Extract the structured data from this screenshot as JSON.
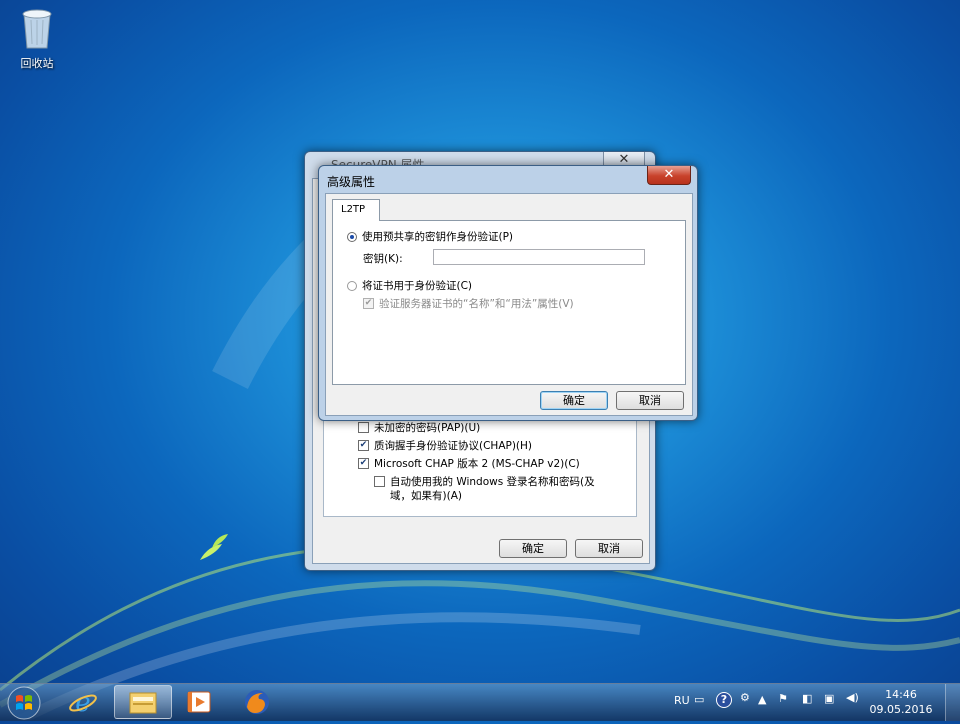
{
  "desktop": {
    "recycle_bin_label": "回收站"
  },
  "background_window": {
    "title": "SecureVPN 属性",
    "close_label": "✕",
    "auth_options": [
      {
        "label": "未加密的密码(PAP)(U)",
        "checked": false
      },
      {
        "label": "质询握手身份验证协议(CHAP)(H)",
        "checked": true
      },
      {
        "label": "Microsoft CHAP 版本 2 (MS-CHAP v2)(C)",
        "checked": true
      }
    ],
    "auto_login_line1": "自动使用我的 Windows 登录名称和密码(及",
    "auto_login_line2": "域，如果有)(A)",
    "ok_label": "确定",
    "cancel_label": "取消"
  },
  "dialog": {
    "title": "高级属性",
    "close_label": "✕",
    "tab_label": "L2TP",
    "psk_option_label": "使用预共享的密钥作身份验证(P)",
    "key_label": "密钥(K):",
    "key_value": "",
    "cert_option_label": "将证书用于身份验证(C)",
    "verify_label": "验证服务器证书的“名称”和“用法”属性(V)",
    "ok_label": "确定",
    "cancel_label": "取消"
  },
  "taskbar": {
    "language": "RU",
    "time": "14:46",
    "date": "09.05.2016"
  },
  "icons": [
    "recycle-bin-icon",
    "windows-start-icon",
    "ie-icon",
    "explorer-icon",
    "media-player-icon",
    "firefox-icon",
    "help-icon",
    "flag-icon",
    "network-icon",
    "volume-icon"
  ]
}
